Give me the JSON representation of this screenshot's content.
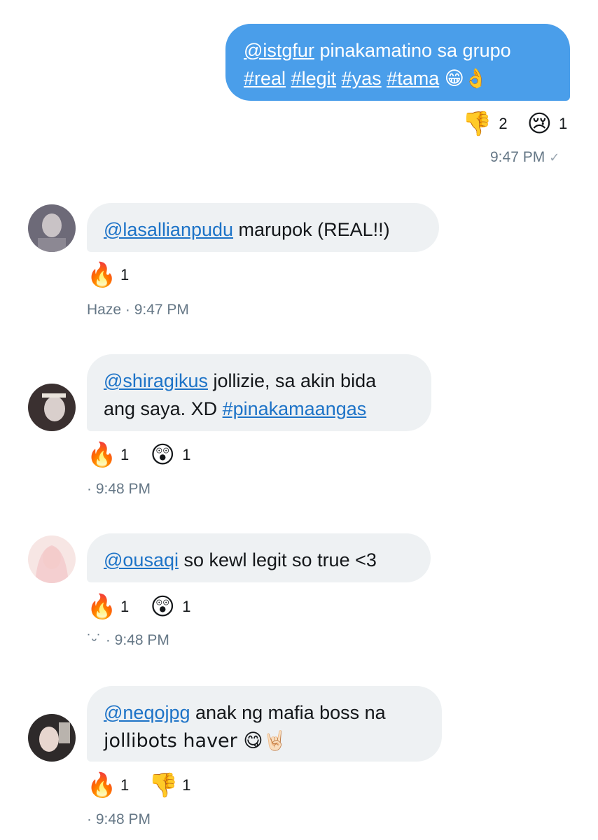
{
  "outgoing": {
    "line1": {
      "mention": "@istgfur",
      "text": " pinakamatino sa grupo"
    },
    "line2": {
      "tags": [
        "#real",
        "#legit",
        "#yas",
        "#tama"
      ],
      "emoji": "😁👌"
    },
    "reactions": [
      {
        "icon": "thumbs-down",
        "emoji": "👎",
        "count": "2"
      },
      {
        "icon": "crying-face",
        "emoji": "😢",
        "count": "1"
      }
    ],
    "time": "9:47 PM",
    "status": "✓"
  },
  "messages": [
    {
      "avatar_colors": [
        "#6d6a78",
        "#c9c3c6"
      ],
      "lines": [
        {
          "mention": "@lasallianpudu",
          "text": " marupok (REAL!!)"
        }
      ],
      "reactions": [
        {
          "icon": "fire",
          "emoji": "🔥",
          "count": "1"
        }
      ],
      "sender": "Haze",
      "time": "· 9:47 PM"
    },
    {
      "avatar_colors": [
        "#3a3030",
        "#d9cfcc"
      ],
      "lines": [
        {
          "mention": "@shiragikus",
          "text": " jollizie, sa akin bida"
        },
        {
          "text": "ang saya. XD ",
          "tag": "#pinakamaangas"
        }
      ],
      "reactions": [
        {
          "icon": "fire",
          "emoji": "🔥",
          "count": "1"
        },
        {
          "icon": "astonished-face",
          "emoji": "😲",
          "count": "1"
        }
      ],
      "sender": "",
      "time": "· 9:48 PM"
    },
    {
      "avatar_colors": [
        "#f2c4c8",
        "#f7e6e4"
      ],
      "lines": [
        {
          "mention": "@ousaqi",
          "text": " so kewl legit so true <3"
        }
      ],
      "reactions": [
        {
          "icon": "fire",
          "emoji": "🔥",
          "count": "1"
        },
        {
          "icon": "astonished-face",
          "emoji": "😲",
          "count": "1"
        }
      ],
      "sender": "˙⏑˙",
      "time": "· 9:48 PM"
    },
    {
      "avatar_colors": [
        "#2e2a2a",
        "#e7d6cf"
      ],
      "lines": [
        {
          "mention": "@neqojpg",
          "text": " anak ng mafia boss na"
        },
        {
          "text": "jollibots haver 😋🤘🏻"
        }
      ],
      "reactions": [
        {
          "icon": "fire",
          "emoji": "🔥",
          "count": "1"
        },
        {
          "icon": "thumbs-down",
          "emoji": "👎",
          "count": "1"
        }
      ],
      "sender": "",
      "time": "· 9:48 PM"
    }
  ]
}
